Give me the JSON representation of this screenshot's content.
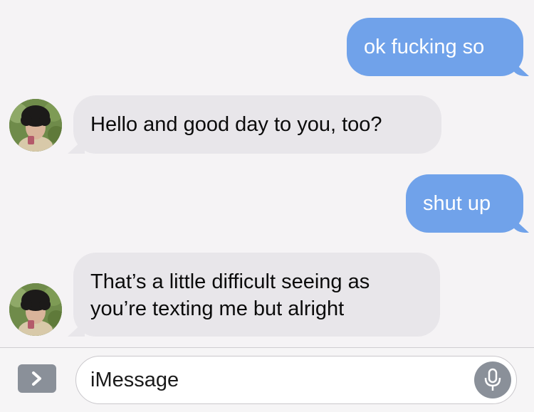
{
  "conversation": {
    "messages": [
      {
        "direction": "sent",
        "text": "ok fucking so"
      },
      {
        "direction": "received",
        "text": "Hello and good day to you, too?"
      },
      {
        "direction": "sent",
        "text": "shut up"
      },
      {
        "direction": "received",
        "text": "That’s a little difficult seeing as you’re texting me but alright"
      }
    ],
    "colors": {
      "sent_bubble": "#70a2ea",
      "received_bubble": "#e8e6ea",
      "background": "#f5f3f5"
    }
  },
  "composer": {
    "placeholder": "iMessage",
    "apps_icon": "chevron-right-icon",
    "mic_icon": "microphone-icon"
  }
}
